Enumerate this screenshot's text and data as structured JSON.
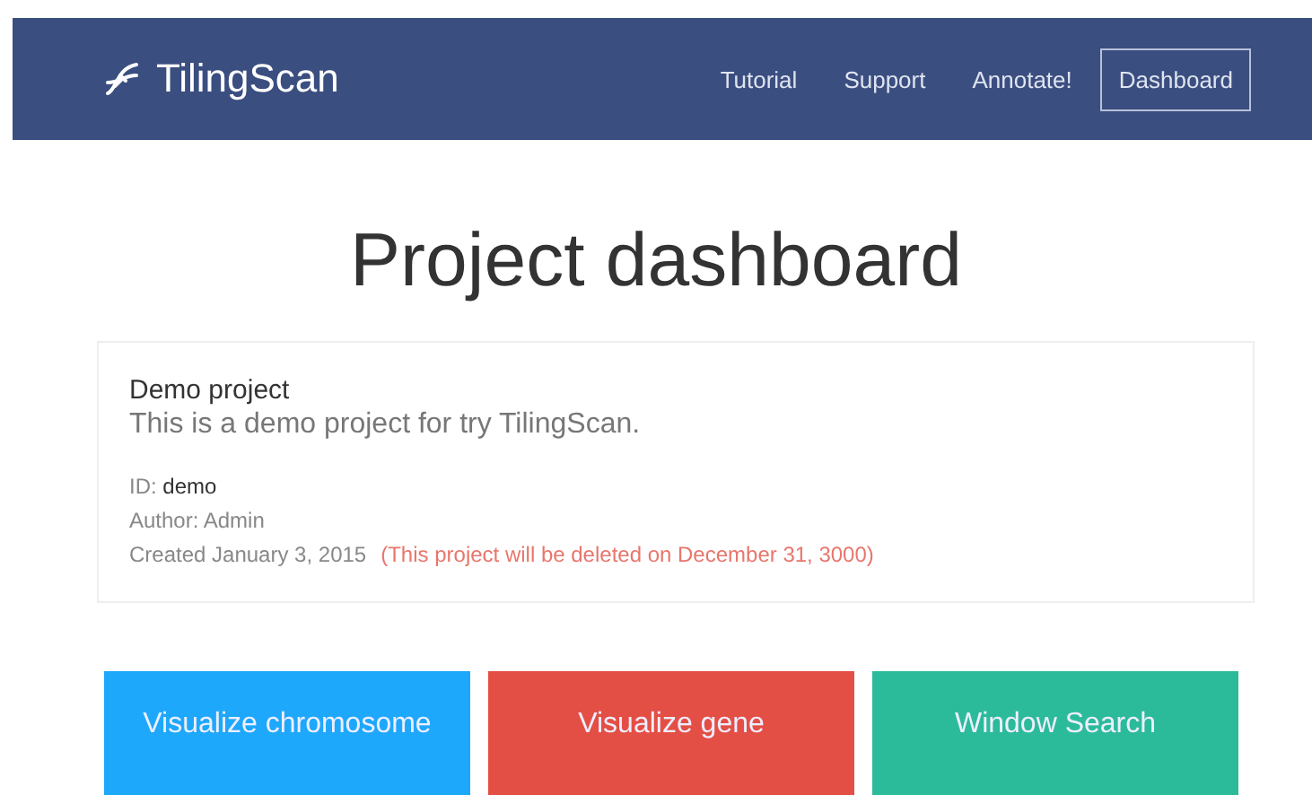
{
  "navbar": {
    "brand": "TilingScan",
    "links": [
      {
        "label": "Tutorial",
        "selected": false
      },
      {
        "label": "Support",
        "selected": false
      },
      {
        "label": "Annotate!",
        "selected": false
      },
      {
        "label": "Dashboard",
        "selected": true
      }
    ]
  },
  "heading": "Project dashboard",
  "project": {
    "name": "Demo project",
    "description": "This is a demo project for try TilingScan.",
    "id_line": "ID: **demo**",
    "author": "Author: Admin",
    "created": "Created January 3, 2015",
    "warning": "(This project will be deleted on December 31, 3000)"
  },
  "actions": [
    {
      "label": "Visualize chromosome",
      "color": "#1ea8fc"
    },
    {
      "label": "Visualize gene",
      "color": "#e44f45"
    },
    {
      "label": "Window Search",
      "color": "#2bbb9b"
    }
  ]
}
